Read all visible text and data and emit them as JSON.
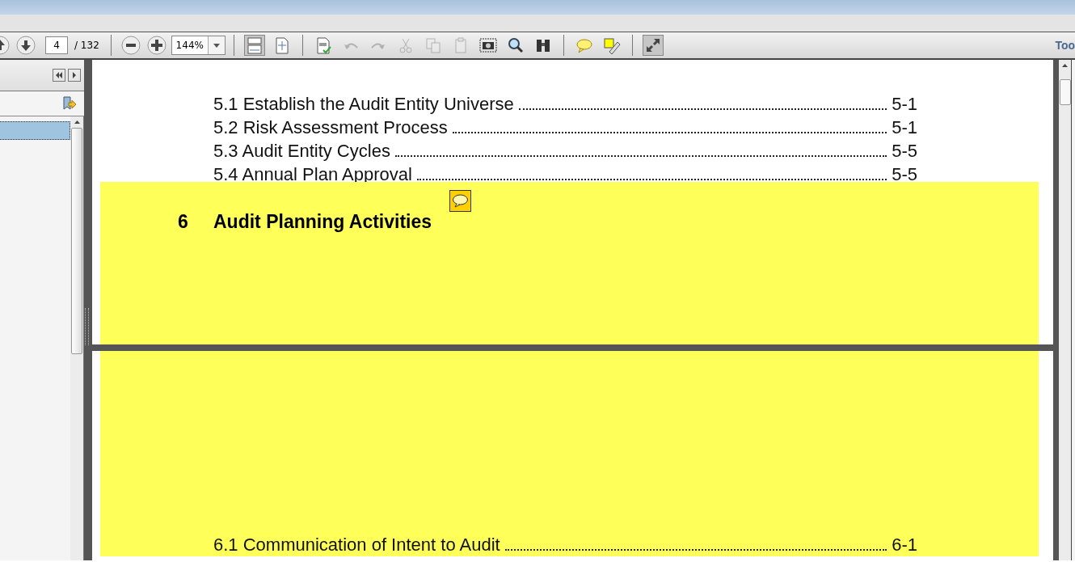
{
  "toolbar": {
    "page_number": "4",
    "page_count": "/ 132",
    "zoom": "144%",
    "tools": [
      {
        "kind": "fit-width",
        "pressed": true,
        "disabled": false
      },
      {
        "kind": "fit-page",
        "pressed": false,
        "disabled": false
      },
      {
        "kind": "spell",
        "pressed": false,
        "disabled": false
      },
      {
        "kind": "undo",
        "pressed": false,
        "disabled": true
      },
      {
        "kind": "redo",
        "pressed": false,
        "disabled": true
      },
      {
        "kind": "cut",
        "pressed": false,
        "disabled": true
      },
      {
        "kind": "copy",
        "pressed": false,
        "disabled": true
      },
      {
        "kind": "paste",
        "pressed": false,
        "disabled": true
      },
      {
        "kind": "snapshot",
        "pressed": false,
        "disabled": false
      },
      {
        "kind": "search",
        "pressed": false,
        "disabled": false
      },
      {
        "kind": "find",
        "pressed": false,
        "disabled": false
      },
      {
        "kind": "comment",
        "pressed": false,
        "disabled": false
      },
      {
        "kind": "textedit",
        "pressed": false,
        "disabled": false
      },
      {
        "kind": "fullscreen",
        "pressed": true,
        "disabled": false
      }
    ],
    "tools_link": "Too"
  },
  "sidebar": {
    "items": [
      {
        "selected": true
      }
    ]
  },
  "page_1": {
    "entries": [
      {
        "text": "5.1 Establish the Audit Entity Universe",
        "page": "5-1"
      },
      {
        "text": "5.2 Risk Assessment Process",
        "page": "5-1"
      },
      {
        "text": "5.3 Audit Entity Cycles",
        "page": "5-5"
      },
      {
        "text": "5.4 Annual Plan Approval",
        "page": "5-5"
      }
    ],
    "heading": {
      "number": "6",
      "title": "Audit Planning Activities",
      "highlighted": true,
      "comment": true
    }
  },
  "page_2": {
    "highlighted": true,
    "entries": [
      {
        "text": "6.1 Communication of Intent to Audit",
        "page": "6-1"
      }
    ]
  }
}
